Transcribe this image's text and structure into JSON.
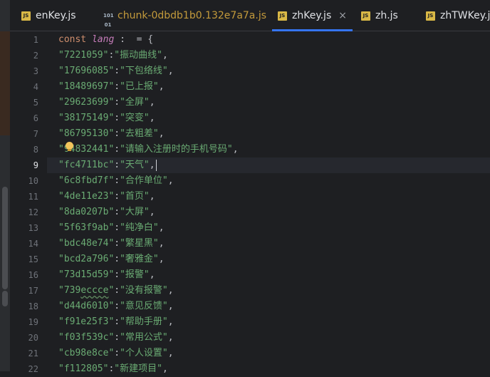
{
  "tabs": [
    {
      "label": "enKey.js",
      "icon": "js-file-icon",
      "icon_text": "JS",
      "color": "#dfe1e5"
    },
    {
      "label": "chunk-0dbdb1b0.132e7a7a.js",
      "icon": "binary-file-icon",
      "icon_text": "101\n01",
      "color": "#c39a3b"
    },
    {
      "label": "zhKey.js",
      "icon": "js-file-icon",
      "icon_text": "JS",
      "color": "#dfe1e5",
      "active": true,
      "close": "×"
    },
    {
      "label": "zh.js",
      "icon": "js-file-icon",
      "icon_text": "JS",
      "color": "#dfe1e5"
    },
    {
      "label": "zhTWKey.js",
      "icon": "js-file-icon",
      "icon_text": "JS",
      "color": "#dfe1e5"
    }
  ],
  "editor": {
    "current_line": 9,
    "lines": [
      {
        "n": "1",
        "kw": "const ",
        "var": "lang",
        "rest": " :  = {"
      },
      {
        "n": "2",
        "key": "\"7221059\"",
        "val": "\"振动曲线\""
      },
      {
        "n": "3",
        "key": "\"17696085\"",
        "val": "\"下包络线\""
      },
      {
        "n": "4",
        "key": "\"18489697\"",
        "val": "\"已上报\""
      },
      {
        "n": "5",
        "key": "\"29623699\"",
        "val": "\"全屏\""
      },
      {
        "n": "6",
        "key": "\"38175149\"",
        "val": "\"突变\""
      },
      {
        "n": "7",
        "key": "\"86795130\"",
        "val": "\"去粗差\""
      },
      {
        "n": "8",
        "key": "\"94832441\"",
        "val": "\"请输入注册时的手机号码\""
      },
      {
        "n": "9",
        "key": "\"fc4711bc\"",
        "val": "\"天气\""
      },
      {
        "n": "10",
        "key": "\"6c8fbd7f\"",
        "val": "\"合作单位\""
      },
      {
        "n": "11",
        "key": "\"4de11e23\"",
        "val": "\"首页\""
      },
      {
        "n": "12",
        "key": "\"8da0207b\"",
        "val": "\"大屏\""
      },
      {
        "n": "13",
        "key": "\"5f63f9ab\"",
        "val": "\"纯净白\""
      },
      {
        "n": "14",
        "key": "\"bdc48e74\"",
        "val": "\"繁星黑\""
      },
      {
        "n": "15",
        "key": "\"bcd2a796\"",
        "val": "\"奢雅金\""
      },
      {
        "n": "16",
        "key": "\"73d15d59\"",
        "val": "\"报警\""
      },
      {
        "n": "17",
        "key": "\"739eccce\"",
        "val": "\"没有报警\"",
        "squiggle": "eccce"
      },
      {
        "n": "18",
        "key": "\"d44d6010\"",
        "val": "\"意见反馈\""
      },
      {
        "n": "19",
        "key": "\"f91e25f3\"",
        "val": "\"帮助手册\""
      },
      {
        "n": "20",
        "key": "\"f03f539c\"",
        "val": "\"常用公式\""
      },
      {
        "n": "21",
        "key": "\"cb98e8ce\"",
        "val": "\"个人设置\""
      },
      {
        "n": "22",
        "key": "\"f112805\"",
        "val": "\"新建项目\""
      }
    ]
  }
}
